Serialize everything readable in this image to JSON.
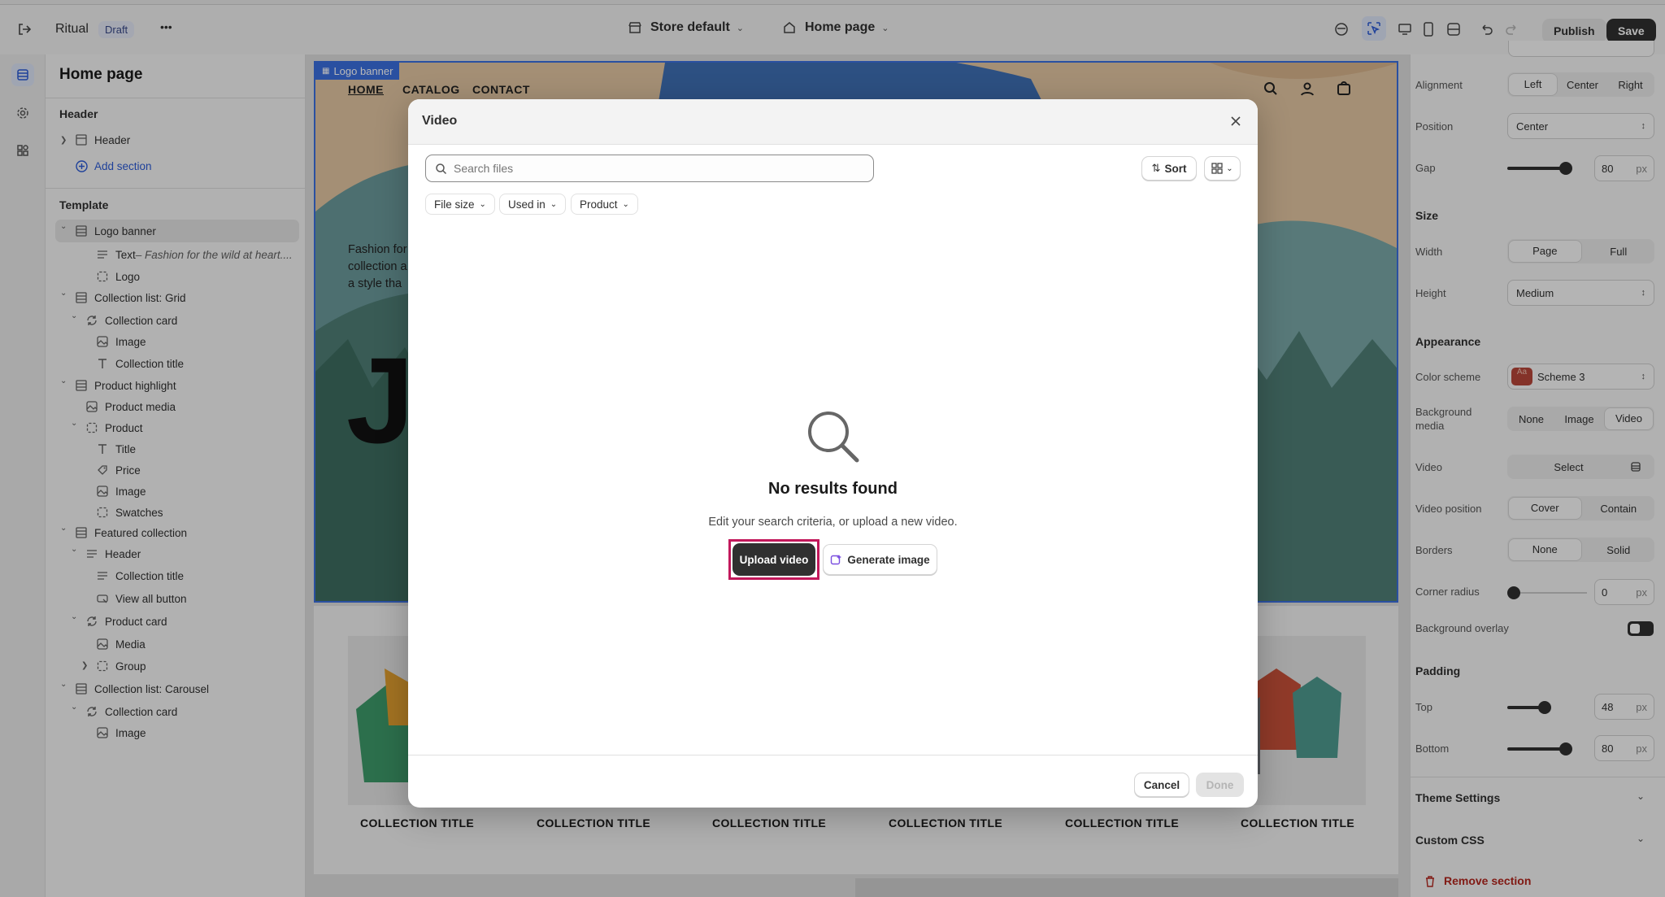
{
  "topbar": {
    "store_name": "Ritual",
    "status_badge": "Draft",
    "more_label": "•••",
    "theme_selector": "Store default",
    "page_selector": "Home page",
    "publish_label": "Publish",
    "save_label": "Save"
  },
  "sidebar": {
    "title": "Home page",
    "header_group": "Header",
    "header_item": "Header",
    "add_section": "Add section",
    "template_group": "Template",
    "items": [
      {
        "label": "Logo banner",
        "sub": ""
      },
      {
        "label": "Text",
        "sub": " – Fashion for the wild at heart...."
      },
      {
        "label": "Logo",
        "sub": ""
      },
      {
        "label": "Collection list: Grid",
        "sub": ""
      },
      {
        "label": "Collection card",
        "sub": ""
      },
      {
        "label": "Image",
        "sub": ""
      },
      {
        "label": "Collection title",
        "sub": ""
      },
      {
        "label": "Product highlight",
        "sub": ""
      },
      {
        "label": "Product media",
        "sub": ""
      },
      {
        "label": "Product",
        "sub": ""
      },
      {
        "label": "Title",
        "sub": ""
      },
      {
        "label": "Price",
        "sub": ""
      },
      {
        "label": "Image",
        "sub": ""
      },
      {
        "label": "Swatches",
        "sub": ""
      },
      {
        "label": "Featured collection",
        "sub": ""
      },
      {
        "label": "Header",
        "sub": ""
      },
      {
        "label": "Collection title",
        "sub": ""
      },
      {
        "label": "View all button",
        "sub": ""
      },
      {
        "label": "Product card",
        "sub": ""
      },
      {
        "label": "Media",
        "sub": ""
      },
      {
        "label": "Group",
        "sub": ""
      },
      {
        "label": "Collection list: Carousel",
        "sub": ""
      },
      {
        "label": "Collection card",
        "sub": ""
      },
      {
        "label": "Image",
        "sub": ""
      }
    ]
  },
  "preview": {
    "section_tag": "Logo banner",
    "nav": [
      "HOME",
      "CATALOG",
      "CONTACT"
    ],
    "hero_text_lines": [
      "Fashion for",
      "collection a",
      "a style tha"
    ],
    "hero_big_letter": "J",
    "collection_titles": [
      "COLLECTION TITLE",
      "COLLECTION TITLE",
      "COLLECTION TITLE",
      "COLLECTION TITLE",
      "COLLECTION TITLE",
      "COLLECTION TITLE"
    ]
  },
  "right_panel": {
    "alignment_label": "Alignment",
    "alignment_options": [
      "Left",
      "Center",
      "Right"
    ],
    "position_label": "Position",
    "position_value": "Center",
    "gap_label": "Gap",
    "gap_value": "80",
    "px": "px",
    "size_heading": "Size",
    "width_label": "Width",
    "width_options": [
      "Page",
      "Full"
    ],
    "height_label": "Height",
    "height_value": "Medium",
    "appearance_heading": "Appearance",
    "color_scheme_label": "Color scheme",
    "color_scheme_value": "Scheme 3",
    "color_scheme_swatch": "Aa",
    "bg_media_label_1": "Background",
    "bg_media_label_2": "media",
    "bg_media_options": [
      "None",
      "Image",
      "Video"
    ],
    "video_label": "Video",
    "video_select": "Select",
    "video_position_label": "Video position",
    "video_position_options": [
      "Cover",
      "Contain"
    ],
    "borders_label": "Borders",
    "borders_options": [
      "None",
      "Solid"
    ],
    "corner_radius_label": "Corner radius",
    "corner_radius_value": "0",
    "bg_overlay_label": "Background overlay",
    "padding_heading": "Padding",
    "top_label": "Top",
    "top_value": "48",
    "bottom_label": "Bottom",
    "bottom_value": "80",
    "theme_settings": "Theme Settings",
    "custom_css": "Custom CSS",
    "remove_section": "Remove section"
  },
  "modal": {
    "title": "Video",
    "search_placeholder": "Search files",
    "sort_label": "Sort",
    "filters": [
      "File size",
      "Used in",
      "Product"
    ],
    "empty_title": "No results found",
    "empty_text": "Edit your search criteria, or upload a new video.",
    "upload_label": "Upload video",
    "generate_label": "Generate image",
    "cancel_label": "Cancel",
    "done_label": "Done"
  },
  "colors": {
    "accent_blue": "#3b6fe0",
    "highlight_red": "#c2185b",
    "remove_red": "#b3261e",
    "dark_button": "#303030"
  }
}
